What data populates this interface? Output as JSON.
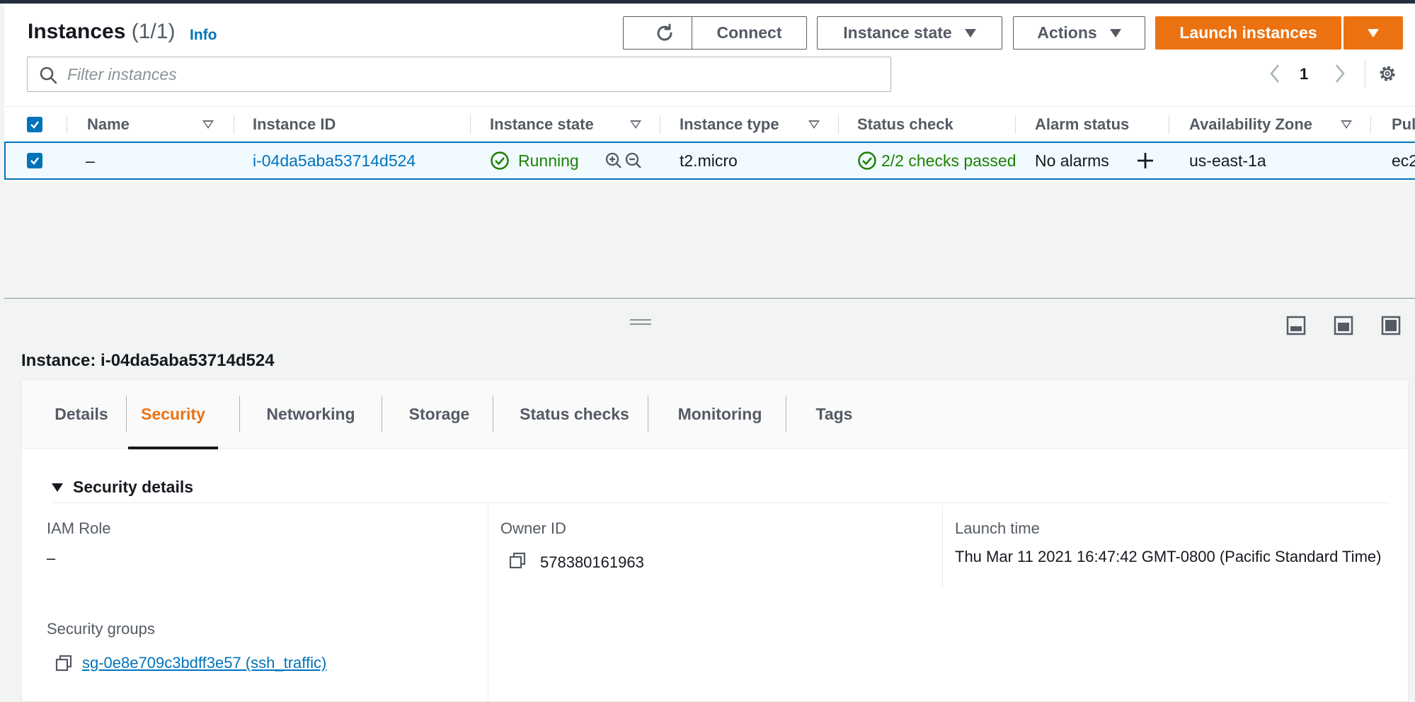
{
  "header": {
    "title": "Instances",
    "count": "(1/1)",
    "info": "Info",
    "buttons": {
      "connect": "Connect",
      "instance_state": "Instance state",
      "actions": "Actions",
      "launch": "Launch instances"
    }
  },
  "search": {
    "placeholder": "Filter instances"
  },
  "pagination": {
    "page": "1"
  },
  "table": {
    "columns": [
      "Name",
      "Instance ID",
      "Instance state",
      "Instance type",
      "Status check",
      "Alarm status",
      "Availability Zone",
      "Pul"
    ],
    "rows": [
      {
        "name": "–",
        "instance_id": "i-04da5aba53714d524",
        "state": "Running",
        "type": "t2.micro",
        "status_check": "2/2 checks passed",
        "alarm": "No alarms",
        "zone": "us-east-1a",
        "public": "ec2"
      }
    ]
  },
  "detail": {
    "title": "Instance: i-04da5aba53714d524",
    "tabs": [
      "Details",
      "Security",
      "Networking",
      "Storage",
      "Status checks",
      "Monitoring",
      "Tags"
    ],
    "active_tab": "Security",
    "section_title": "Security details",
    "fields": {
      "iam_role_label": "IAM Role",
      "iam_role_value": "–",
      "owner_id_label": "Owner ID",
      "owner_id_value": "578380161963",
      "launch_time_label": "Launch time",
      "launch_time_value": "Thu Mar 11 2021 16:47:42 GMT-0800 (Pacific Standard Time)",
      "security_groups_label": "Security groups",
      "security_group_link": "sg-0e8e709c3bdff3e57 (ssh_traffic)"
    }
  },
  "colors": {
    "accent_orange": "#ec7211",
    "link_blue": "#0073bb",
    "success_green": "#1d8102",
    "text_dark": "#16191f",
    "text_gray": "#545b64"
  },
  "icons": [
    "refresh-icon",
    "caret-down-icon",
    "search-icon",
    "chevron-left-icon",
    "chevron-right-icon",
    "gear-icon",
    "check-circle-icon",
    "zoom-in-icon",
    "zoom-out-icon",
    "plus-icon",
    "drag-handle-icon",
    "copy-icon",
    "panel-bottom-icon",
    "panel-split-icon",
    "panel-full-icon"
  ]
}
